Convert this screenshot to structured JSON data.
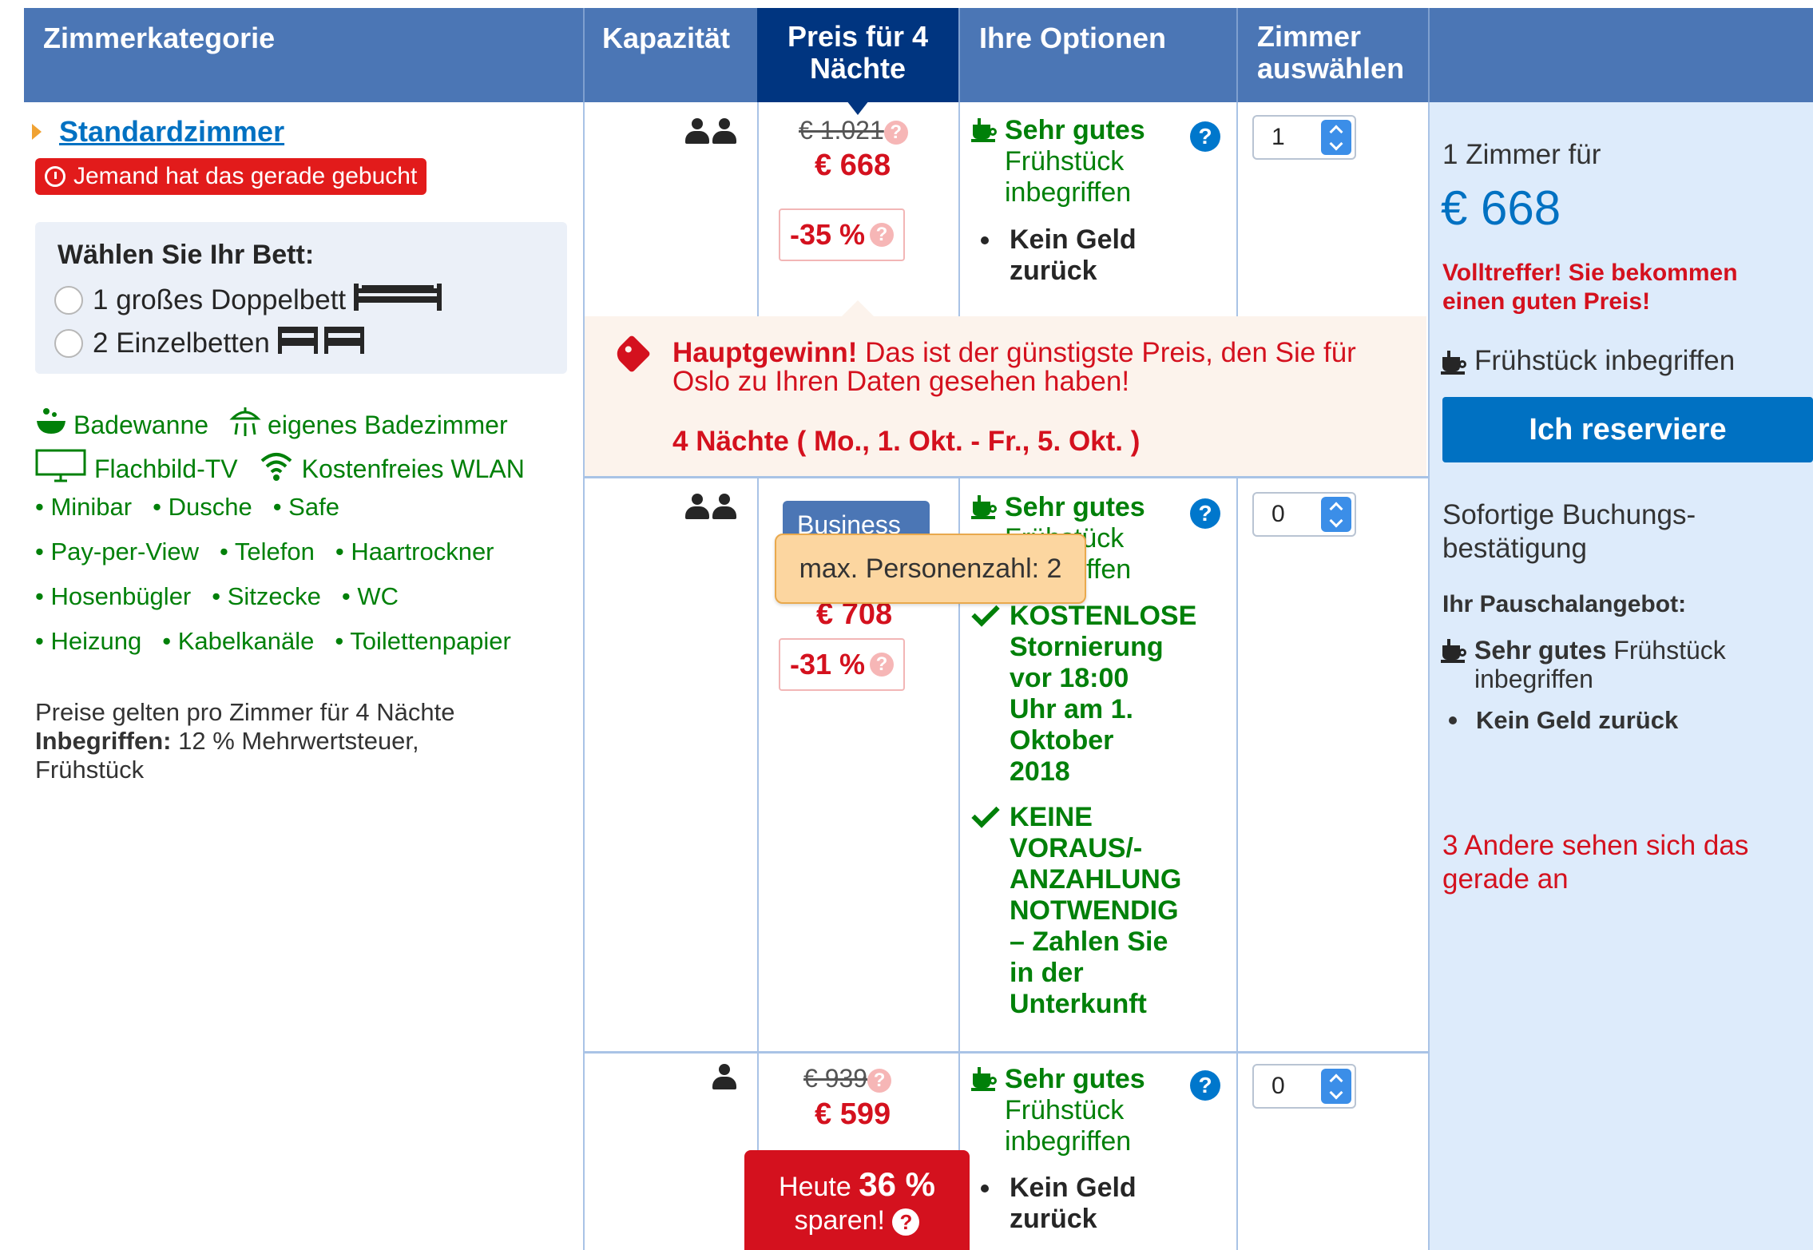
{
  "header": {
    "room_category": "Zimmerkategorie",
    "capacity": "Kapazität",
    "price_line1": "Preis für 4",
    "price_line2": "Nächte",
    "options": "Ihre Optionen",
    "select_line1": "Zimmer",
    "select_line2": "auswählen"
  },
  "room": {
    "name": "Standardzimmer",
    "booked_badge": "Jemand hat das gerade gebucht",
    "bed_heading": "Wählen Sie Ihr Bett:",
    "bed_options": [
      "1 großes Doppelbett",
      "2 Einzelbetten"
    ],
    "facilities_icon": [
      {
        "icon": "bathtub-icon",
        "label": "Badewanne"
      },
      {
        "icon": "shower-icon",
        "label": "eigenes Badezimmer"
      },
      {
        "icon": "tv-icon",
        "label": "Flachbild-TV"
      },
      {
        "icon": "wifi-icon",
        "label": "Kostenfreies WLAN"
      }
    ],
    "facilities": [
      [
        "Minibar",
        "Dusche",
        "Safe"
      ],
      [
        "Pay-per-View",
        "Telefon",
        "Haartrockner"
      ],
      [
        "Hosenbügler",
        "Sitzecke",
        "WC"
      ],
      [
        "Heizung",
        "Kabelkanäle",
        "Toilettenpapier"
      ]
    ],
    "note_line1": "Preise gelten pro Zimmer für 4 Nächte",
    "note_included_label": "Inbegriffen:",
    "note_included_value": "12 % Mehrwertsteuer,",
    "note_line3": "Frühstück"
  },
  "rows": [
    {
      "old_price": "€ 1.021",
      "new_price": "€ 668",
      "discount": "-35 %",
      "breakfast_bold": "Sehr gutes",
      "breakfast_rest1": "Frühstück",
      "breakfast_rest2": "inbegriffen",
      "no_refund1": "Kein Geld",
      "no_refund2": "zurück",
      "selected": "1"
    },
    {
      "badge": "Business",
      "tooltip": "max. Personenzahl: 2",
      "new_price": "€ 708",
      "discount": "-31 %",
      "breakfast_bold": "Sehr gutes",
      "breakfast_rest1": "Frühstück",
      "breakfast_rest2": "inbegriffen",
      "cancel_lines": [
        "KOSTENLOSE",
        "Stornierung",
        "vor 18:00",
        "Uhr am 1.",
        "Oktober",
        "2018"
      ],
      "prepay_lines": [
        "KEINE",
        "VORAUS/-",
        "ANZAHLUNG",
        "NOTWENDIG",
        "– Zahlen Sie",
        "in der",
        "Unterkunft"
      ],
      "selected": "0"
    },
    {
      "old_price": "€ 939",
      "new_price": "€ 599",
      "breakfast_bold": "Sehr gutes",
      "breakfast_rest1": "Frühstück",
      "breakfast_rest2": "inbegriffen",
      "no_refund1": "Kein Geld",
      "no_refund2": "zurück",
      "sale_pre": "Heute",
      "sale_pct": "36 %",
      "sale_post": "sparen!",
      "selected": "0"
    }
  ],
  "promo": {
    "bold": "Hauptgewinn!",
    "text": " Das ist der günstigste Preis, den Sie für Oslo zu Ihren Daten gesehen haben!",
    "nights": "4 Nächte ( Mo., 1. Okt. - Fr., 5. Okt. )"
  },
  "summary": {
    "rooms_for": "1 Zimmer für",
    "price": "€ 668",
    "hit_text": "Volltreffer! Sie bekommen einen guten Preis!",
    "breakfast": "Frühstück inbegriffen",
    "reserve_button": "Ich reserviere",
    "instant_line1": "Sofortige Buchungs-",
    "instant_line2": "bestätigung",
    "package_heading": "Ihr Pauschalangebot:",
    "package_breakfast_bold": "Sehr gutes",
    "package_breakfast_rest1": "Frühstück",
    "package_breakfast_rest2": "inbegriffen",
    "package_no_refund": "Kein Geld zurück",
    "others_viewing": "3 Andere sehen sich das gerade an"
  },
  "colors": {
    "header_bg": "#4b76b5",
    "header_active": "#003580",
    "accent_blue": "#0071c2",
    "red": "#d4111e",
    "green": "#008009",
    "summary_bg": "#ddebfb"
  }
}
